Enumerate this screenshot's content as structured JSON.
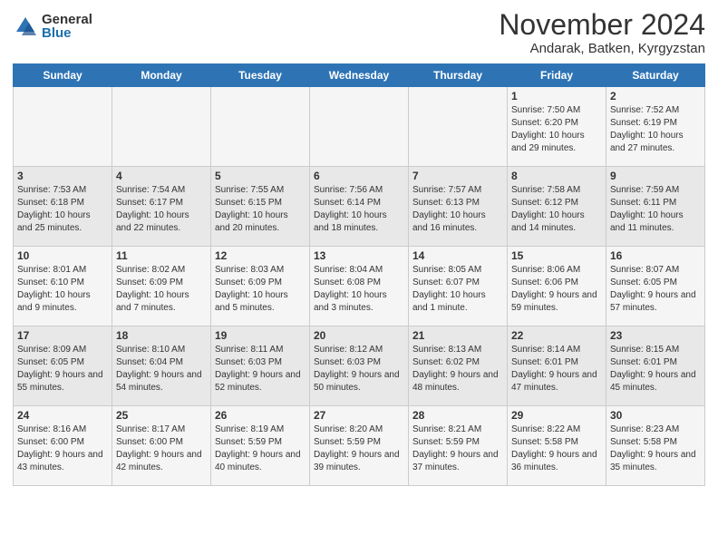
{
  "logo": {
    "general": "General",
    "blue": "Blue"
  },
  "title": "November 2024",
  "subtitle": "Andarak, Batken, Kyrgyzstan",
  "weekdays": [
    "Sunday",
    "Monday",
    "Tuesday",
    "Wednesday",
    "Thursday",
    "Friday",
    "Saturday"
  ],
  "weeks": [
    [
      {
        "day": "",
        "info": ""
      },
      {
        "day": "",
        "info": ""
      },
      {
        "day": "",
        "info": ""
      },
      {
        "day": "",
        "info": ""
      },
      {
        "day": "",
        "info": ""
      },
      {
        "day": "1",
        "info": "Sunrise: 7:50 AM\nSunset: 6:20 PM\nDaylight: 10 hours and 29 minutes."
      },
      {
        "day": "2",
        "info": "Sunrise: 7:52 AM\nSunset: 6:19 PM\nDaylight: 10 hours and 27 minutes."
      }
    ],
    [
      {
        "day": "3",
        "info": "Sunrise: 7:53 AM\nSunset: 6:18 PM\nDaylight: 10 hours and 25 minutes."
      },
      {
        "day": "4",
        "info": "Sunrise: 7:54 AM\nSunset: 6:17 PM\nDaylight: 10 hours and 22 minutes."
      },
      {
        "day": "5",
        "info": "Sunrise: 7:55 AM\nSunset: 6:15 PM\nDaylight: 10 hours and 20 minutes."
      },
      {
        "day": "6",
        "info": "Sunrise: 7:56 AM\nSunset: 6:14 PM\nDaylight: 10 hours and 18 minutes."
      },
      {
        "day": "7",
        "info": "Sunrise: 7:57 AM\nSunset: 6:13 PM\nDaylight: 10 hours and 16 minutes."
      },
      {
        "day": "8",
        "info": "Sunrise: 7:58 AM\nSunset: 6:12 PM\nDaylight: 10 hours and 14 minutes."
      },
      {
        "day": "9",
        "info": "Sunrise: 7:59 AM\nSunset: 6:11 PM\nDaylight: 10 hours and 11 minutes."
      }
    ],
    [
      {
        "day": "10",
        "info": "Sunrise: 8:01 AM\nSunset: 6:10 PM\nDaylight: 10 hours and 9 minutes."
      },
      {
        "day": "11",
        "info": "Sunrise: 8:02 AM\nSunset: 6:09 PM\nDaylight: 10 hours and 7 minutes."
      },
      {
        "day": "12",
        "info": "Sunrise: 8:03 AM\nSunset: 6:09 PM\nDaylight: 10 hours and 5 minutes."
      },
      {
        "day": "13",
        "info": "Sunrise: 8:04 AM\nSunset: 6:08 PM\nDaylight: 10 hours and 3 minutes."
      },
      {
        "day": "14",
        "info": "Sunrise: 8:05 AM\nSunset: 6:07 PM\nDaylight: 10 hours and 1 minute."
      },
      {
        "day": "15",
        "info": "Sunrise: 8:06 AM\nSunset: 6:06 PM\nDaylight: 9 hours and 59 minutes."
      },
      {
        "day": "16",
        "info": "Sunrise: 8:07 AM\nSunset: 6:05 PM\nDaylight: 9 hours and 57 minutes."
      }
    ],
    [
      {
        "day": "17",
        "info": "Sunrise: 8:09 AM\nSunset: 6:05 PM\nDaylight: 9 hours and 55 minutes."
      },
      {
        "day": "18",
        "info": "Sunrise: 8:10 AM\nSunset: 6:04 PM\nDaylight: 9 hours and 54 minutes."
      },
      {
        "day": "19",
        "info": "Sunrise: 8:11 AM\nSunset: 6:03 PM\nDaylight: 9 hours and 52 minutes."
      },
      {
        "day": "20",
        "info": "Sunrise: 8:12 AM\nSunset: 6:03 PM\nDaylight: 9 hours and 50 minutes."
      },
      {
        "day": "21",
        "info": "Sunrise: 8:13 AM\nSunset: 6:02 PM\nDaylight: 9 hours and 48 minutes."
      },
      {
        "day": "22",
        "info": "Sunrise: 8:14 AM\nSunset: 6:01 PM\nDaylight: 9 hours and 47 minutes."
      },
      {
        "day": "23",
        "info": "Sunrise: 8:15 AM\nSunset: 6:01 PM\nDaylight: 9 hours and 45 minutes."
      }
    ],
    [
      {
        "day": "24",
        "info": "Sunrise: 8:16 AM\nSunset: 6:00 PM\nDaylight: 9 hours and 43 minutes."
      },
      {
        "day": "25",
        "info": "Sunrise: 8:17 AM\nSunset: 6:00 PM\nDaylight: 9 hours and 42 minutes."
      },
      {
        "day": "26",
        "info": "Sunrise: 8:19 AM\nSunset: 5:59 PM\nDaylight: 9 hours and 40 minutes."
      },
      {
        "day": "27",
        "info": "Sunrise: 8:20 AM\nSunset: 5:59 PM\nDaylight: 9 hours and 39 minutes."
      },
      {
        "day": "28",
        "info": "Sunrise: 8:21 AM\nSunset: 5:59 PM\nDaylight: 9 hours and 37 minutes."
      },
      {
        "day": "29",
        "info": "Sunrise: 8:22 AM\nSunset: 5:58 PM\nDaylight: 9 hours and 36 minutes."
      },
      {
        "day": "30",
        "info": "Sunrise: 8:23 AM\nSunset: 5:58 PM\nDaylight: 9 hours and 35 minutes."
      }
    ]
  ]
}
